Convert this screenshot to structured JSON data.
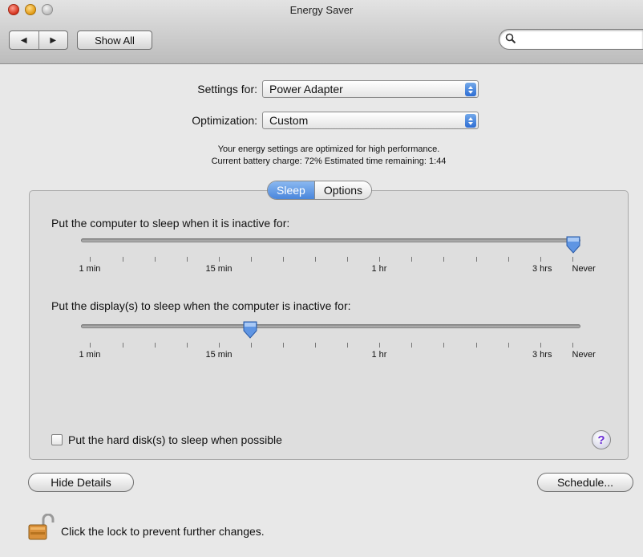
{
  "window": {
    "title": "Energy Saver"
  },
  "toolbar": {
    "back_glyph": "◀",
    "forward_glyph": "▶",
    "show_all_label": "Show All",
    "search_placeholder": ""
  },
  "settings": {
    "settings_for_label": "Settings for:",
    "settings_for_value": "Power Adapter",
    "optimization_label": "Optimization:",
    "optimization_value": "Custom",
    "info_line1": "Your energy settings are optimized for high performance.",
    "info_line2": "Current battery charge: 72%  Estimated time remaining: 1:44"
  },
  "tabs": [
    {
      "label": "Sleep",
      "active": true
    },
    {
      "label": "Options",
      "active": false
    }
  ],
  "sleep": {
    "computer_label": "Put the computer to sleep when it is inactive for:",
    "computer_value": "Never",
    "display_label": "Put the display(s) to sleep when the computer is inactive for:",
    "display_value": "15 min",
    "scale_labels": [
      "1 min",
      "15 min",
      "1 hr",
      "3 hrs",
      "Never"
    ],
    "hard_disk_label": "Put the hard disk(s) to sleep when possible",
    "hard_disk_checked": false,
    "help_glyph": "?"
  },
  "footer": {
    "hide_details_label": "Hide Details",
    "schedule_label": "Schedule...",
    "lock_text": "Click the lock to prevent further changes."
  },
  "colors": {
    "accent": "#4a86dc",
    "help": "#6a2bd6",
    "lock": "#d9903a"
  }
}
